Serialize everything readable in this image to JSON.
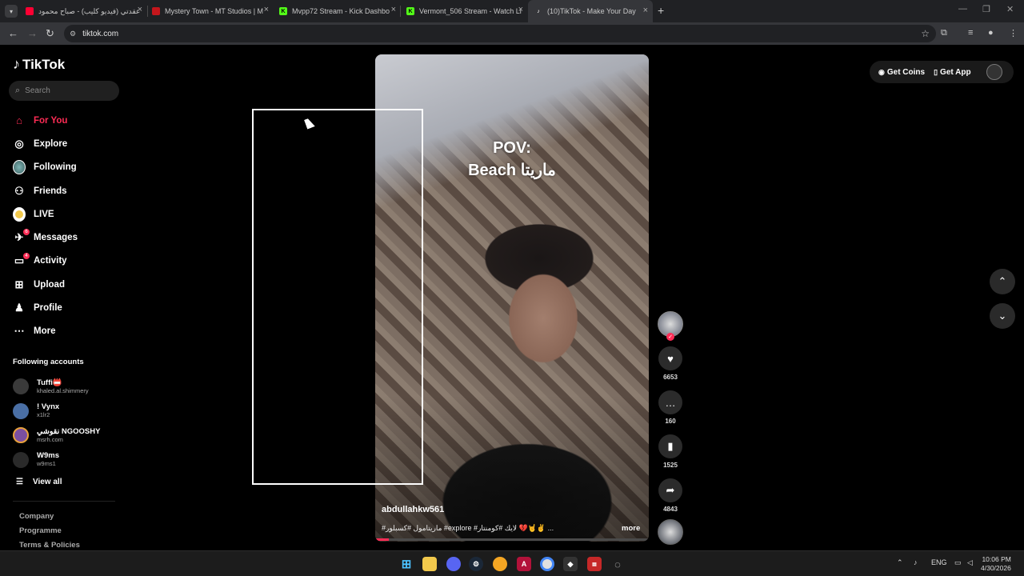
{
  "browser": {
    "tabs": [
      {
        "title": "عقدتي (فيديو كليب) - صباح محمود",
        "favicon_color": "#ff0033",
        "active": false
      },
      {
        "title": "Mystery Town - MT Studios | M",
        "favicon_color": "#c4161c",
        "active": false
      },
      {
        "title": "Mvpp72 Stream - Kick Dashbo",
        "favicon_color": "#53fc18",
        "active": false
      },
      {
        "title": "Vermont_506 Stream - Watch Li",
        "favicon_color": "#53fc18",
        "active": false
      },
      {
        "title": "(10)TikTok - Make Your Day",
        "favicon_color": "#ffffff",
        "active": true
      }
    ],
    "url": "tiktok.com"
  },
  "tiktok": {
    "logo_text": "TikTok",
    "search_placeholder": "Search",
    "nav": [
      {
        "label": "For You",
        "icon": "home-icon",
        "active": true
      },
      {
        "label": "Explore",
        "icon": "compass-icon",
        "active": false
      },
      {
        "label": "Following",
        "icon": "following-avatar-icon",
        "active": false
      },
      {
        "label": "Friends",
        "icon": "friends-icon",
        "active": false
      },
      {
        "label": "LIVE",
        "icon": "live-icon",
        "active": false
      },
      {
        "label": "Messages",
        "icon": "messages-icon",
        "active": false,
        "badge": "6"
      },
      {
        "label": "Activity",
        "icon": "activity-icon",
        "active": false,
        "badge": "4"
      },
      {
        "label": "Upload",
        "icon": "upload-icon",
        "active": false
      },
      {
        "label": "Profile",
        "icon": "profile-icon",
        "active": false
      },
      {
        "label": "More",
        "icon": "more-icon",
        "active": false
      }
    ],
    "following_title": "Following accounts",
    "accounts": [
      {
        "name": "Tuffi📛",
        "username": "khaled.al.shimmery",
        "avatar_color": "#3a3a3a"
      },
      {
        "name": "! Vynx",
        "username": "x1lr2",
        "avatar_color": "#4a6fa5"
      },
      {
        "name": "نقوشي NGOOSHY",
        "username": "msrh.com",
        "avatar_color": "#7b4fa0"
      },
      {
        "name": "W9ms",
        "username": "w9ms1",
        "avatar_color": "#2a2a2a"
      }
    ],
    "view_all": "View all",
    "footer": [
      "Company",
      "Programme",
      "Terms & Policies"
    ],
    "header": {
      "get_coins": "Get Coins",
      "get_app": "Get App"
    },
    "video": {
      "overlay_line1": "POV:",
      "overlay_line2": "Beach ماريتا",
      "author": "abdullahkw561",
      "caption": "#ماريتامول #كسبلور #explore #لايك #كومنتار 💔🤘✌️ ...",
      "more": "more",
      "progress_fraction": 0.05
    },
    "actions": {
      "likes": "6653",
      "comments": "160",
      "saves": "1525",
      "shares": "4843"
    }
  },
  "taskbar": {
    "language": "ENG",
    "time": "10:06 PM",
    "date": "4/30/2026"
  }
}
